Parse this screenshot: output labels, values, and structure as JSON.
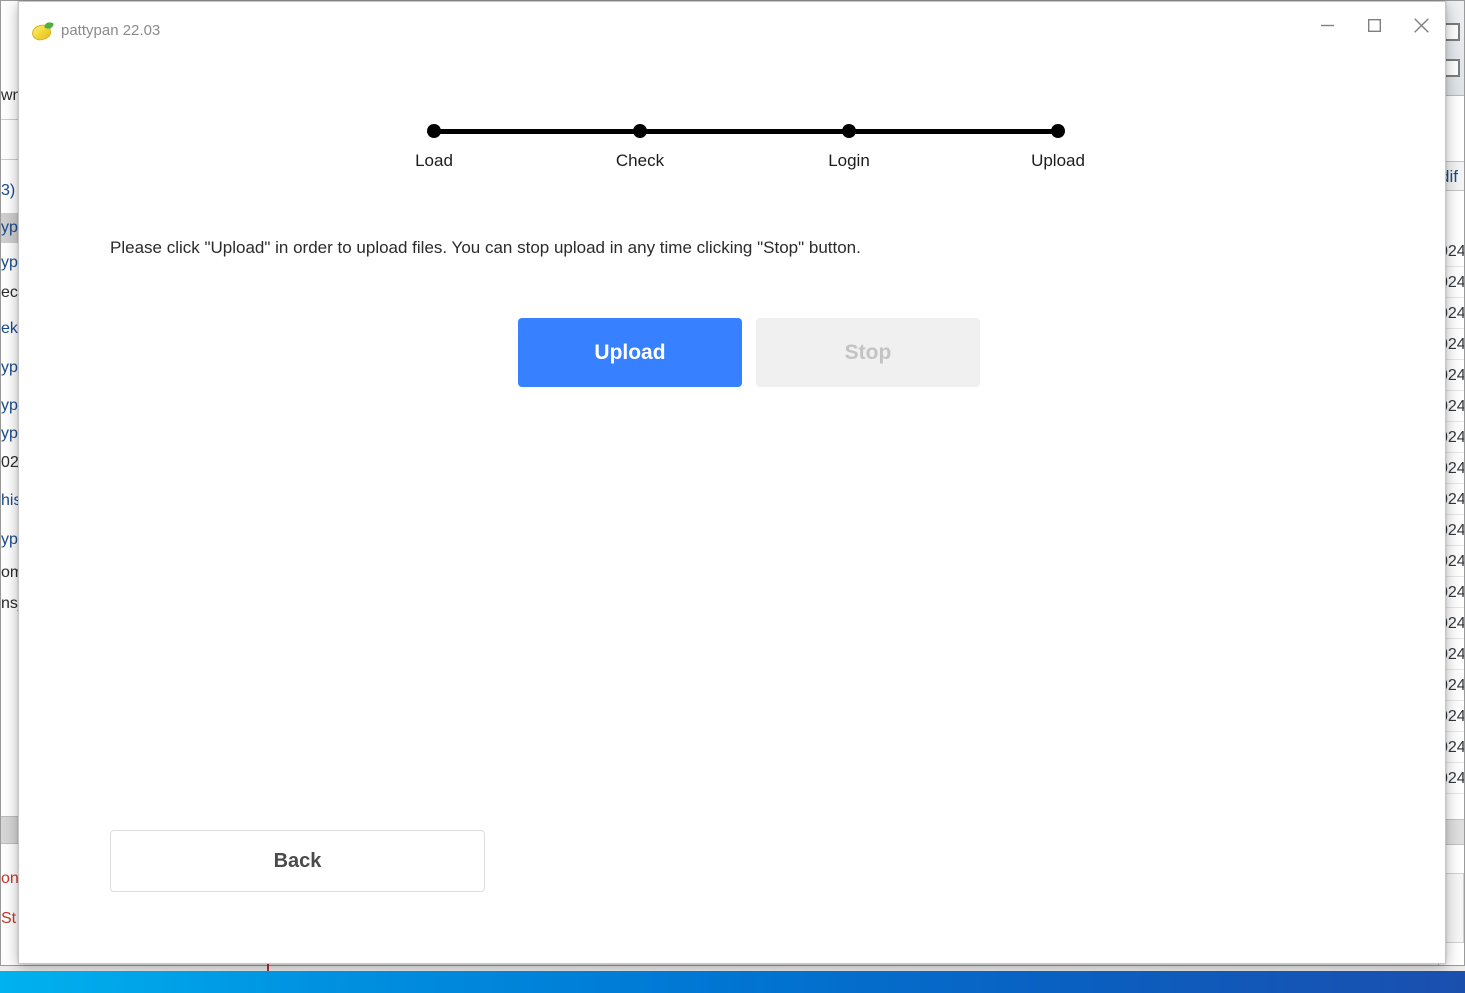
{
  "window": {
    "title": "pattypan 22.03",
    "icon": "lemon-icon",
    "controls": {
      "minimize": "minimize-icon",
      "maximize": "maximize-icon",
      "close": "close-icon"
    }
  },
  "stepper": {
    "steps": [
      {
        "label": "Load",
        "state": "complete"
      },
      {
        "label": "Check",
        "state": "complete"
      },
      {
        "label": "Login",
        "state": "complete"
      },
      {
        "label": "Upload",
        "state": "current"
      }
    ]
  },
  "main": {
    "instruction": "Please click \"Upload\" in order to upload files. You can stop upload in any time clicking \"Stop\" button.",
    "upload_label": "Upload",
    "stop_label": "Stop",
    "back_label": "Back"
  },
  "colors": {
    "accent_blue": "#3780ff",
    "upload_text": "#ffffff",
    "stop_background": "#f0f0f0",
    "stop_text": "#c3c3c3",
    "back_text": "#4a4a4a",
    "stepper": "#000000",
    "title_text": "#8a8a8a",
    "taskbar_gradient_start": "#00b2ef",
    "taskbar_gradient_end": "#1b4fae"
  },
  "background_window": {
    "column_header_fragment": "dif",
    "left_fragments": [
      "wn",
      "3)",
      "yp",
      "yp",
      "ec",
      "ek",
      "yp",
      "yp",
      "yp",
      "02",
      "his",
      "yp",
      "om",
      "ns_"
    ],
    "left_fragments_bottom": [
      "on",
      "St"
    ],
    "right_cell_fragment": "024",
    "right_cell_count": 18
  }
}
